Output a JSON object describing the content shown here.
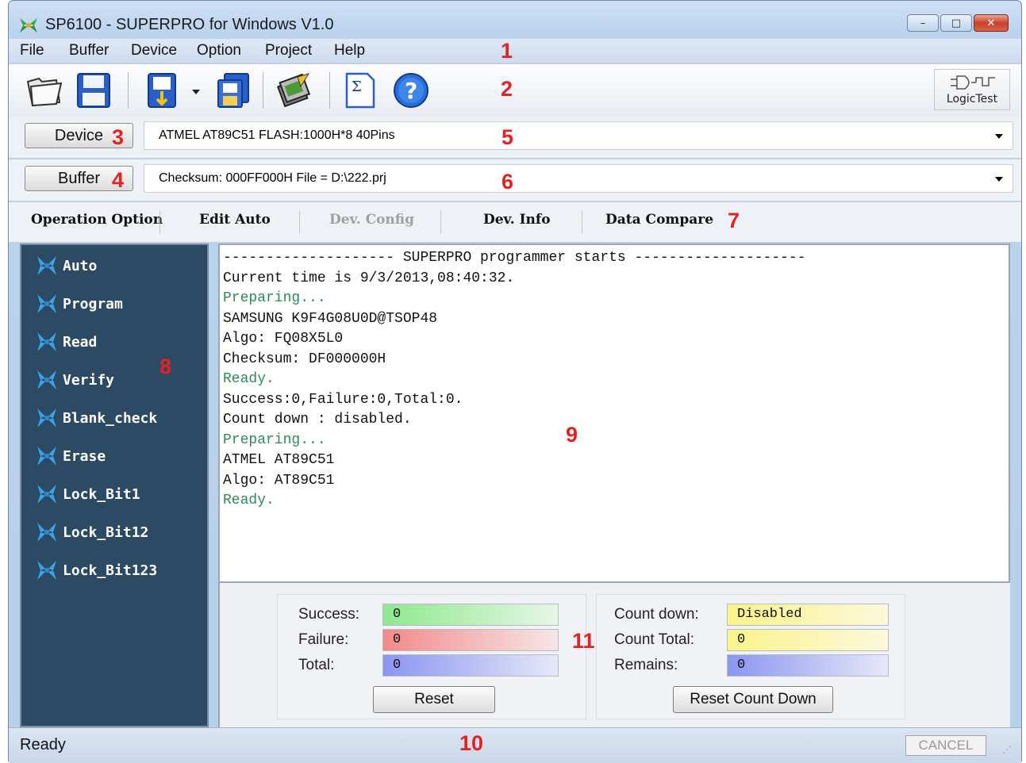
{
  "window": {
    "title": "SP6100 - SUPERPRO for Windows V1.0",
    "minimize_glyph": "–",
    "maximize_glyph": "□",
    "close_glyph": "✕"
  },
  "menu": {
    "items": [
      "File",
      "Buffer",
      "Device",
      "Option",
      "Project",
      "Help"
    ]
  },
  "toolbar": {
    "logic_label": "LogicTest",
    "icons": [
      "open-folder-icon",
      "save-disk-icon",
      "load-project-icon",
      "dropdown-arrow-icon",
      "save-project-icon",
      "program-chip-icon",
      "checksum-sigma-icon",
      "help-icon"
    ]
  },
  "device_row": {
    "button_label": "Device",
    "combo_value": "ATMEL  AT89C51  FLASH:1000H*8  40Pins"
  },
  "buffer_row": {
    "button_label": "Buffer",
    "combo_value": "Checksum: 000FF000H    File = D:\\222.prj"
  },
  "tabs": [
    {
      "label": "Operation Option",
      "enabled": true
    },
    {
      "label": "Edit Auto",
      "enabled": true
    },
    {
      "label": "Dev. Config",
      "enabled": false
    },
    {
      "label": "Dev. Info",
      "enabled": true
    },
    {
      "label": "Data Compare",
      "enabled": true
    }
  ],
  "operations": [
    "Auto",
    "Program",
    "Read",
    "Verify",
    "Blank_check",
    "Erase",
    "Lock_Bit1",
    "Lock_Bit12",
    "Lock_Bit123"
  ],
  "log": [
    {
      "text": "-------------------- SUPERPRO programmer starts --------------------",
      "color": "black"
    },
    {
      "text": "Current time is 9/3/2013,08:40:32.",
      "color": "black"
    },
    {
      "text": "Preparing...",
      "color": "green"
    },
    {
      "text": "SAMSUNG K9F4G08U0D@TSOP48",
      "color": "black"
    },
    {
      "text": "Algo: FQ08X5L0",
      "color": "black"
    },
    {
      "text": "Checksum: DF000000H",
      "color": "black"
    },
    {
      "text": "Ready.",
      "color": "green"
    },
    {
      "text": "Success:0,Failure:0,Total:0.",
      "color": "black"
    },
    {
      "text": "Count down : disabled.",
      "color": "black"
    },
    {
      "text": "Preparing...",
      "color": "green"
    },
    {
      "text": "ATMEL AT89C51",
      "color": "black"
    },
    {
      "text": "Algo: AT89C51",
      "color": "black"
    },
    {
      "text": "Ready.",
      "color": "green"
    }
  ],
  "stats": {
    "success_label": "Success:",
    "success_value": "0",
    "failure_label": "Failure:",
    "failure_value": "0",
    "total_label": "Total:",
    "total_value": "0",
    "reset_label": "Reset",
    "countdown_label": "Count down:",
    "countdown_value": "Disabled",
    "count_total_label": "Count Total:",
    "count_total_value": "0",
    "remains_label": "Remains:",
    "remains_value": "0",
    "reset_countdown_label": "Reset Count Down"
  },
  "status": {
    "text": "Ready",
    "cancel_label": "CANCEL"
  },
  "callouts": [
    "1",
    "2",
    "3",
    "4",
    "5",
    "6",
    "7",
    "8",
    "9",
    "10",
    "11"
  ],
  "colors": {
    "sidebar": "#2c4a63",
    "success_fill": "#8fe88f",
    "failure_fill": "#f28a8a",
    "total_fill": "#8b95f0",
    "countdown_fill": "#fbf38a",
    "callout": "#e42222",
    "log_green": "#2e8b57"
  }
}
